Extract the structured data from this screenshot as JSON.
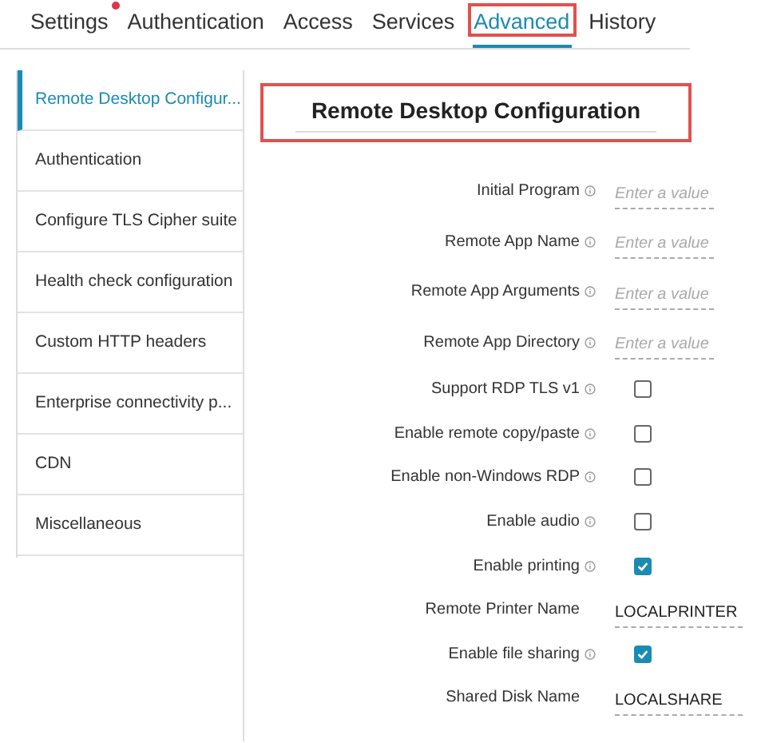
{
  "tabs": [
    {
      "label": "Settings",
      "selected": false,
      "highlighted": false,
      "dot": true
    },
    {
      "label": "Authentication",
      "selected": false,
      "highlighted": false,
      "dot": false
    },
    {
      "label": "Access",
      "selected": false,
      "highlighted": false,
      "dot": false
    },
    {
      "label": "Services",
      "selected": false,
      "highlighted": false,
      "dot": false
    },
    {
      "label": "Advanced",
      "selected": true,
      "highlighted": true,
      "dot": false
    },
    {
      "label": "History",
      "selected": false,
      "highlighted": false,
      "dot": false
    }
  ],
  "sidebar": {
    "items": [
      {
        "label": "Remote Desktop Configur...",
        "selected": true
      },
      {
        "label": "Authentication",
        "selected": false
      },
      {
        "label": "Configure TLS Cipher suite",
        "selected": false
      },
      {
        "label": "Health check configuration",
        "selected": false
      },
      {
        "label": "Custom HTTP headers",
        "selected": false
      },
      {
        "label": "Enterprise connectivity p...",
        "selected": false
      },
      {
        "label": "CDN",
        "selected": false
      },
      {
        "label": "Miscellaneous",
        "selected": false
      }
    ]
  },
  "panel": {
    "title": "Remote Desktop Configuration",
    "highlighted": true,
    "fields": [
      {
        "kind": "text",
        "label": "Initial Program",
        "info": true,
        "placeholder": "Enter a value"
      },
      {
        "kind": "text",
        "label": "Remote App Name",
        "info": true,
        "placeholder": "Enter a value"
      },
      {
        "kind": "text",
        "label": "Remote App Arguments",
        "info": true,
        "placeholder": "Enter a value"
      },
      {
        "kind": "text",
        "label": "Remote App Directory",
        "info": true,
        "placeholder": "Enter a value"
      },
      {
        "kind": "checkbox",
        "label": "Support RDP TLS v1",
        "info": true,
        "checked": false
      },
      {
        "kind": "checkbox",
        "label": "Enable remote copy/paste",
        "info": true,
        "checked": false
      },
      {
        "kind": "checkbox",
        "label": "Enable non-Windows RDP",
        "info": true,
        "checked": false
      },
      {
        "kind": "checkbox",
        "label": "Enable audio",
        "info": true,
        "checked": false
      },
      {
        "kind": "checkbox",
        "label": "Enable printing",
        "info": true,
        "checked": true
      },
      {
        "kind": "text",
        "label": "Remote Printer Name",
        "info": false,
        "value": "LOCALPRINTER"
      },
      {
        "kind": "checkbox",
        "label": "Enable file sharing",
        "info": true,
        "checked": true
      },
      {
        "kind": "text",
        "label": "Shared Disk Name",
        "info": false,
        "value": "LOCALSHARE"
      }
    ]
  }
}
